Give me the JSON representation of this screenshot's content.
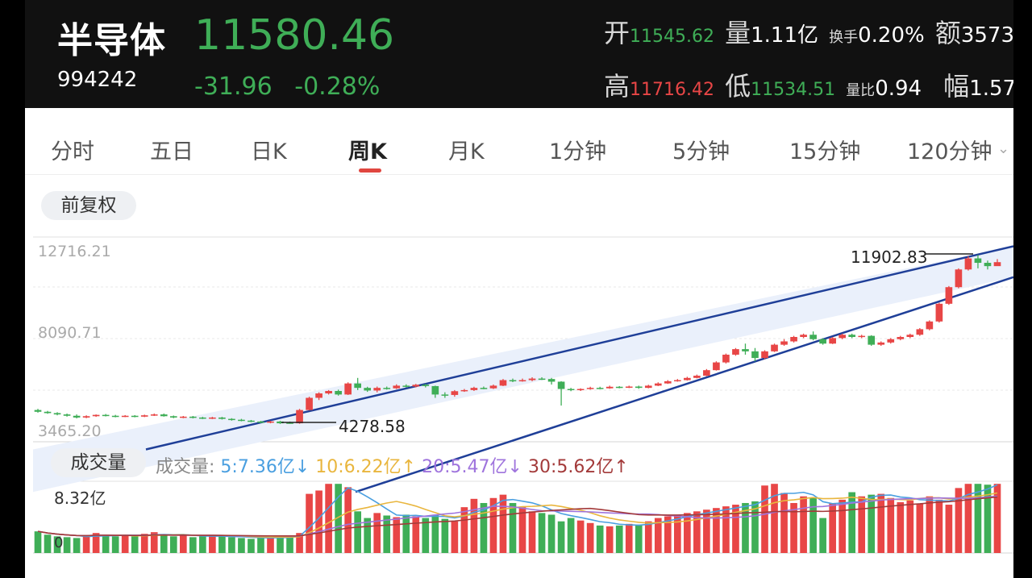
{
  "header": {
    "name": "半导体",
    "code": "994242",
    "price": "11580.46",
    "change": "-31.96",
    "change_pct": "-0.28%",
    "stats": {
      "open_label": "开",
      "open": "11545.62",
      "volume_label": "量",
      "volume": "1.11亿",
      "turnover_label": "换手",
      "turnover": "0.20%",
      "amount_label": "额",
      "amount": "3573",
      "high_label": "高",
      "high": "11716.42",
      "low_label": "低",
      "low": "11534.51",
      "vol_ratio_label": "量比",
      "vol_ratio": "0.94",
      "amplitude_label": "幅",
      "amplitude": "1.57"
    }
  },
  "tabs": [
    "分时",
    "五日",
    "日K",
    "周K",
    "月K",
    "1分钟",
    "5分钟",
    "15分钟",
    "120分钟"
  ],
  "active_tab": "周K",
  "adjust_label": "前复权",
  "price_axis": {
    "max": "12716.21",
    "mid": "8090.71",
    "min": "3465.20"
  },
  "annotations": {
    "high": "11902.83",
    "low": "4278.58"
  },
  "volume_panel": {
    "title": "成交量",
    "legend_label": "成交量:",
    "ma5": "5:7.36亿",
    "ma10": "10:6.22亿",
    "ma20": "20:5.47亿",
    "ma30": "30:5.62亿",
    "max_label": "8.32亿",
    "zero_label": "0"
  },
  "colors": {
    "up": "#e84646",
    "down": "#3fae57",
    "channel": "#1f3f98",
    "channel_fill": "#eaf0fb"
  },
  "chart_data": {
    "type": "candlestick",
    "ylim": [
      3465.2,
      12716.21
    ],
    "candles": [
      [
        4900,
        4820,
        4950,
        4780
      ],
      [
        4820,
        4760,
        4860,
        4730
      ],
      [
        4760,
        4700,
        4800,
        4660
      ],
      [
        4700,
        4640,
        4740,
        4600
      ],
      [
        4640,
        4560,
        4700,
        4520
      ],
      [
        4560,
        4620,
        4660,
        4530
      ],
      [
        4620,
        4680,
        4700,
        4590
      ],
      [
        4680,
        4640,
        4720,
        4610
      ],
      [
        4640,
        4600,
        4680,
        4570
      ],
      [
        4600,
        4640,
        4670,
        4580
      ],
      [
        4640,
        4600,
        4670,
        4570
      ],
      [
        4600,
        4660,
        4690,
        4580
      ],
      [
        4660,
        4700,
        4740,
        4630
      ],
      [
        4700,
        4620,
        4740,
        4600
      ],
      [
        4620,
        4560,
        4650,
        4530
      ],
      [
        4560,
        4600,
        4630,
        4530
      ],
      [
        4600,
        4560,
        4630,
        4520
      ],
      [
        4560,
        4520,
        4590,
        4490
      ],
      [
        4520,
        4560,
        4590,
        4490
      ],
      [
        4560,
        4500,
        4590,
        4470
      ],
      [
        4500,
        4460,
        4530,
        4420
      ],
      [
        4460,
        4420,
        4500,
        4390
      ],
      [
        4420,
        4380,
        4450,
        4350
      ],
      [
        4380,
        4340,
        4410,
        4310
      ],
      [
        4340,
        4380,
        4410,
        4300
      ],
      [
        4380,
        4300,
        4410,
        4270
      ],
      [
        4330,
        4300,
        4380,
        4278
      ],
      [
        4300,
        4900,
        4950,
        4278
      ],
      [
        4900,
        5450,
        5500,
        4880
      ],
      [
        5450,
        5650,
        5700,
        5350
      ],
      [
        5650,
        5760,
        5800,
        5600
      ],
      [
        5760,
        5600,
        5820,
        5550
      ],
      [
        5600,
        6100,
        6150,
        5580
      ],
      [
        6100,
        5900,
        6350,
        5800
      ],
      [
        5900,
        5780,
        5950,
        5720
      ],
      [
        5780,
        5900,
        5960,
        5700
      ],
      [
        5900,
        5880,
        5960,
        5820
      ],
      [
        5880,
        6000,
        6060,
        5850
      ],
      [
        6000,
        5960,
        6060,
        5920
      ],
      [
        5960,
        6040,
        6080,
        5920
      ],
      [
        6040,
        5980,
        6080,
        5920
      ],
      [
        5980,
        5600,
        6000,
        5450
      ],
      [
        5600,
        5580,
        5700,
        5450
      ],
      [
        5580,
        5750,
        5800,
        5500
      ],
      [
        5750,
        5800,
        5850,
        5720
      ],
      [
        5800,
        5900,
        5950,
        5760
      ],
      [
        5900,
        5880,
        5960,
        5840
      ],
      [
        5880,
        6000,
        6050,
        5850
      ],
      [
        6000,
        6250,
        6300,
        5980
      ],
      [
        6250,
        6220,
        6320,
        6160
      ],
      [
        6220,
        6250,
        6320,
        6180
      ],
      [
        6250,
        6320,
        6380,
        6200
      ],
      [
        6320,
        6300,
        6380,
        6260
      ],
      [
        6300,
        6180,
        6350,
        6050
      ],
      [
        6180,
        5850,
        6200,
        5100
      ],
      [
        5850,
        5800,
        5900,
        5750
      ],
      [
        5800,
        5850,
        5880,
        5760
      ],
      [
        5850,
        5900,
        5950,
        5820
      ],
      [
        5900,
        5880,
        5950,
        5840
      ],
      [
        5880,
        5950,
        6000,
        5860
      ],
      [
        5950,
        5920,
        5980,
        5880
      ],
      [
        5920,
        5960,
        6000,
        5890
      ],
      [
        5960,
        5900,
        6000,
        5860
      ],
      [
        5900,
        6000,
        6040,
        5880
      ],
      [
        6000,
        6100,
        6150,
        5980
      ],
      [
        6100,
        6200,
        6250,
        6080
      ],
      [
        6200,
        6250,
        6300,
        6180
      ],
      [
        6250,
        6350,
        6400,
        6230
      ],
      [
        6350,
        6450,
        6500,
        6330
      ],
      [
        6450,
        6700,
        6750,
        6430
      ],
      [
        6700,
        7050,
        7100,
        6680
      ],
      [
        7050,
        7400,
        7450,
        7000
      ],
      [
        7400,
        7650,
        7700,
        7350
      ],
      [
        7650,
        7550,
        7900,
        7400
      ],
      [
        7550,
        7250,
        7700,
        7100
      ],
      [
        7250,
        7550,
        7600,
        7200
      ],
      [
        7550,
        7850,
        7900,
        7520
      ],
      [
        7850,
        8000,
        8100,
        7800
      ],
      [
        8000,
        8200,
        8250,
        7950
      ],
      [
        8200,
        8300,
        8350,
        8150
      ],
      [
        8300,
        8100,
        8450,
        8050
      ],
      [
        8100,
        7900,
        8150,
        7850
      ],
      [
        7900,
        8150,
        8200,
        7880
      ],
      [
        8150,
        8300,
        8350,
        8100
      ],
      [
        8300,
        8200,
        8350,
        8150
      ],
      [
        8200,
        8250,
        8300,
        8150
      ],
      [
        8250,
        7850,
        8280,
        7800
      ],
      [
        7850,
        7950,
        8000,
        7800
      ],
      [
        7950,
        8100,
        8150,
        7900
      ],
      [
        8100,
        8200,
        8250,
        8050
      ],
      [
        8200,
        8300,
        8350,
        8150
      ],
      [
        8300,
        8550,
        8600,
        8250
      ],
      [
        8550,
        8900,
        8950,
        8500
      ],
      [
        8900,
        9700,
        9750,
        8850
      ],
      [
        9700,
        10450,
        10500,
        9650
      ],
      [
        10450,
        11250,
        11300,
        10400
      ],
      [
        11250,
        11750,
        11850,
        11200
      ],
      [
        11750,
        11550,
        11902,
        11300
      ],
      [
        11550,
        11400,
        11650,
        11250
      ],
      [
        11400,
        11580,
        11716,
        11534
      ]
    ],
    "volume": [
      2.6,
      2.2,
      2.0,
      1.9,
      1.8,
      2.0,
      2.4,
      2.2,
      2.0,
      2.1,
      2.0,
      2.3,
      2.5,
      2.2,
      2.0,
      2.1,
      1.9,
      2.0,
      2.1,
      2.0,
      1.9,
      1.8,
      1.7,
      1.8,
      1.9,
      2.0,
      1.9,
      2.4,
      7.1,
      7.5,
      8.3,
      8.3,
      7.9,
      5.0,
      4.2,
      4.8,
      4.5,
      4.3,
      4.6,
      4.4,
      4.2,
      4.6,
      4.1,
      3.8,
      5.5,
      6.5,
      6.0,
      6.6,
      7.0,
      6.0,
      5.5,
      5.0,
      4.8,
      4.6,
      3.8,
      4.2,
      3.9,
      3.6,
      3.3,
      3.2,
      3.3,
      3.5,
      3.4,
      3.8,
      4.2,
      4.4,
      4.6,
      4.8,
      5.0,
      5.2,
      5.4,
      5.6,
      5.8,
      6.0,
      6.2,
      8.1,
      8.3,
      7.2,
      6.0,
      6.8,
      6.6,
      4.2,
      6.0,
      6.4,
      7.3,
      6.8,
      7.0,
      7.1,
      6.6,
      6.1,
      6.3,
      5.9,
      6.8,
      6.4,
      5.8,
      7.8,
      8.3,
      8.3,
      8.2,
      8.3
    ],
    "channel": {
      "upper": [
        [
          0,
          3120
        ],
        [
          1,
          12300
        ]
      ],
      "lower": [
        [
          0,
          1200
        ],
        [
          1,
          10900
        ]
      ]
    }
  }
}
